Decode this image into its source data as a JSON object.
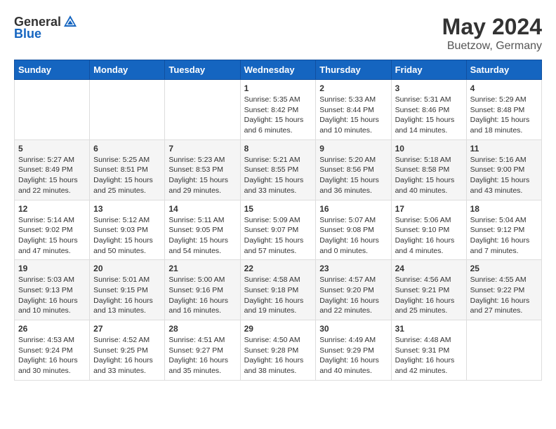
{
  "header": {
    "logo_general": "General",
    "logo_blue": "Blue",
    "month_year": "May 2024",
    "location": "Buetzow, Germany"
  },
  "weekdays": [
    "Sunday",
    "Monday",
    "Tuesday",
    "Wednesday",
    "Thursday",
    "Friday",
    "Saturday"
  ],
  "weeks": [
    [
      {
        "num": "",
        "content": ""
      },
      {
        "num": "",
        "content": ""
      },
      {
        "num": "",
        "content": ""
      },
      {
        "num": "1",
        "content": "Sunrise: 5:35 AM\nSunset: 8:42 PM\nDaylight: 15 hours\nand 6 minutes."
      },
      {
        "num": "2",
        "content": "Sunrise: 5:33 AM\nSunset: 8:44 PM\nDaylight: 15 hours\nand 10 minutes."
      },
      {
        "num": "3",
        "content": "Sunrise: 5:31 AM\nSunset: 8:46 PM\nDaylight: 15 hours\nand 14 minutes."
      },
      {
        "num": "4",
        "content": "Sunrise: 5:29 AM\nSunset: 8:48 PM\nDaylight: 15 hours\nand 18 minutes."
      }
    ],
    [
      {
        "num": "5",
        "content": "Sunrise: 5:27 AM\nSunset: 8:49 PM\nDaylight: 15 hours\nand 22 minutes."
      },
      {
        "num": "6",
        "content": "Sunrise: 5:25 AM\nSunset: 8:51 PM\nDaylight: 15 hours\nand 25 minutes."
      },
      {
        "num": "7",
        "content": "Sunrise: 5:23 AM\nSunset: 8:53 PM\nDaylight: 15 hours\nand 29 minutes."
      },
      {
        "num": "8",
        "content": "Sunrise: 5:21 AM\nSunset: 8:55 PM\nDaylight: 15 hours\nand 33 minutes."
      },
      {
        "num": "9",
        "content": "Sunrise: 5:20 AM\nSunset: 8:56 PM\nDaylight: 15 hours\nand 36 minutes."
      },
      {
        "num": "10",
        "content": "Sunrise: 5:18 AM\nSunset: 8:58 PM\nDaylight: 15 hours\nand 40 minutes."
      },
      {
        "num": "11",
        "content": "Sunrise: 5:16 AM\nSunset: 9:00 PM\nDaylight: 15 hours\nand 43 minutes."
      }
    ],
    [
      {
        "num": "12",
        "content": "Sunrise: 5:14 AM\nSunset: 9:02 PM\nDaylight: 15 hours\nand 47 minutes."
      },
      {
        "num": "13",
        "content": "Sunrise: 5:12 AM\nSunset: 9:03 PM\nDaylight: 15 hours\nand 50 minutes."
      },
      {
        "num": "14",
        "content": "Sunrise: 5:11 AM\nSunset: 9:05 PM\nDaylight: 15 hours\nand 54 minutes."
      },
      {
        "num": "15",
        "content": "Sunrise: 5:09 AM\nSunset: 9:07 PM\nDaylight: 15 hours\nand 57 minutes."
      },
      {
        "num": "16",
        "content": "Sunrise: 5:07 AM\nSunset: 9:08 PM\nDaylight: 16 hours\nand 0 minutes."
      },
      {
        "num": "17",
        "content": "Sunrise: 5:06 AM\nSunset: 9:10 PM\nDaylight: 16 hours\nand 4 minutes."
      },
      {
        "num": "18",
        "content": "Sunrise: 5:04 AM\nSunset: 9:12 PM\nDaylight: 16 hours\nand 7 minutes."
      }
    ],
    [
      {
        "num": "19",
        "content": "Sunrise: 5:03 AM\nSunset: 9:13 PM\nDaylight: 16 hours\nand 10 minutes."
      },
      {
        "num": "20",
        "content": "Sunrise: 5:01 AM\nSunset: 9:15 PM\nDaylight: 16 hours\nand 13 minutes."
      },
      {
        "num": "21",
        "content": "Sunrise: 5:00 AM\nSunset: 9:16 PM\nDaylight: 16 hours\nand 16 minutes."
      },
      {
        "num": "22",
        "content": "Sunrise: 4:58 AM\nSunset: 9:18 PM\nDaylight: 16 hours\nand 19 minutes."
      },
      {
        "num": "23",
        "content": "Sunrise: 4:57 AM\nSunset: 9:20 PM\nDaylight: 16 hours\nand 22 minutes."
      },
      {
        "num": "24",
        "content": "Sunrise: 4:56 AM\nSunset: 9:21 PM\nDaylight: 16 hours\nand 25 minutes."
      },
      {
        "num": "25",
        "content": "Sunrise: 4:55 AM\nSunset: 9:22 PM\nDaylight: 16 hours\nand 27 minutes."
      }
    ],
    [
      {
        "num": "26",
        "content": "Sunrise: 4:53 AM\nSunset: 9:24 PM\nDaylight: 16 hours\nand 30 minutes."
      },
      {
        "num": "27",
        "content": "Sunrise: 4:52 AM\nSunset: 9:25 PM\nDaylight: 16 hours\nand 33 minutes."
      },
      {
        "num": "28",
        "content": "Sunrise: 4:51 AM\nSunset: 9:27 PM\nDaylight: 16 hours\nand 35 minutes."
      },
      {
        "num": "29",
        "content": "Sunrise: 4:50 AM\nSunset: 9:28 PM\nDaylight: 16 hours\nand 38 minutes."
      },
      {
        "num": "30",
        "content": "Sunrise: 4:49 AM\nSunset: 9:29 PM\nDaylight: 16 hours\nand 40 minutes."
      },
      {
        "num": "31",
        "content": "Sunrise: 4:48 AM\nSunset: 9:31 PM\nDaylight: 16 hours\nand 42 minutes."
      },
      {
        "num": "",
        "content": ""
      }
    ]
  ]
}
